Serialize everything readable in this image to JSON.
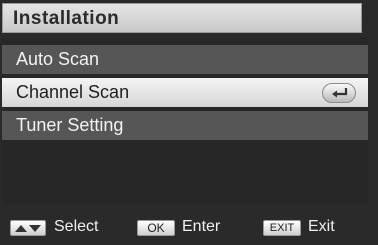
{
  "window": {
    "title": "Installation"
  },
  "menu": {
    "items": [
      {
        "label": "Auto Scan",
        "selected": false
      },
      {
        "label": "Channel Scan",
        "selected": true,
        "icon": "enter-icon"
      },
      {
        "label": "Tuner Setting",
        "selected": false
      }
    ]
  },
  "footer": {
    "hints": [
      {
        "key_icon": "up-down-arrows-icon",
        "key_label": "",
        "label": "Select"
      },
      {
        "key_icon": "ok-key-icon",
        "key_label": "OK",
        "label": "Enter"
      },
      {
        "key_icon": "exit-key-icon",
        "key_label": "EXIT",
        "label": "Exit"
      }
    ]
  },
  "colors": {
    "background": "#2a2a2a",
    "item_background": "#565656",
    "selected_background": "#e6e6e6",
    "title_bar": "#d8d8d8"
  }
}
